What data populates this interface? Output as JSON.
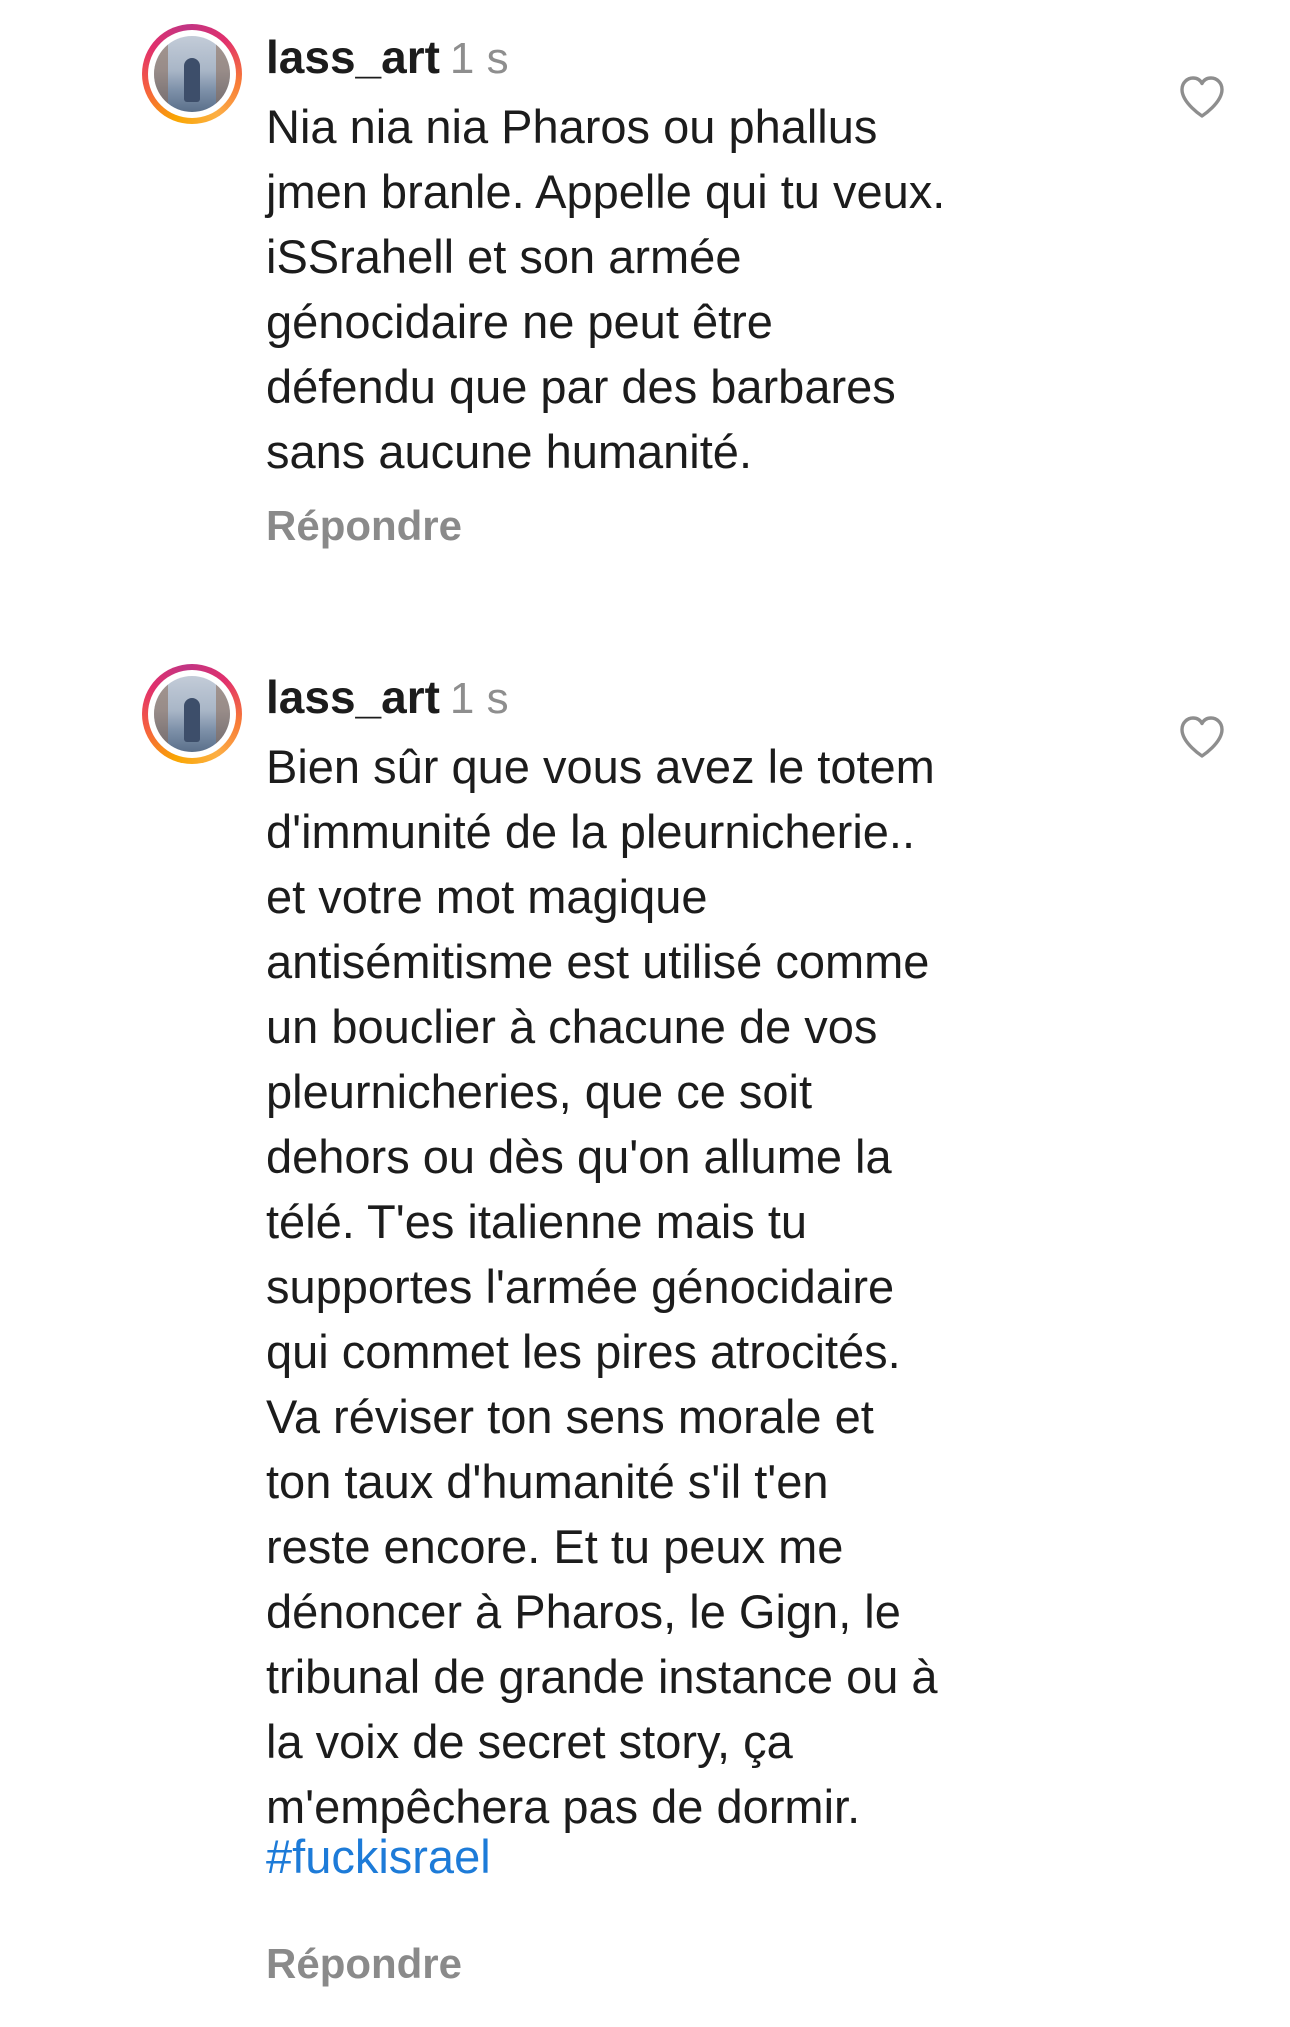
{
  "comments": [
    {
      "username": "lass_art",
      "time": "1 s",
      "text": "Nia nia nia Pharos ou phallus\njmen branle. Appelle qui tu veux.\niSSrahell et son armée\ngénocidaire ne peut être\ndéfendu que par des barbares\nsans aucune humanité.",
      "hashtag": "",
      "reply_label": "Répondre",
      "like_icon": "heart-outline-icon"
    },
    {
      "username": "lass_art",
      "time": "1 s",
      "text": "Bien sûr que vous avez le totem\nd'immunité de la pleurnicherie..\net votre mot magique\nantisémitisme est utilisé comme\nun bouclier à chacune de vos\npleurnicheries, que ce soit\ndehors ou dès qu'on allume la\ntélé. T'es italienne mais tu\nsupportes l'armée génocidaire\nqui commet les pires atrocités.\nVa réviser ton sens morale et\nton taux d'humanité s'il t'en\nreste encore. Et tu peux me\ndénoncer à Pharos, le Gign, le\ntribunal de grande instance ou à\nla voix de secret story, ça\nm'empêchera pas de dormir.",
      "hashtag": "#fuckisrael",
      "reply_label": "Répondre",
      "like_icon": "heart-outline-icon"
    }
  ],
  "colors": {
    "text": "#1c1c1c",
    "meta": "#8e8e8e",
    "hashtag": "#1d7bd8",
    "reply": "#8a8a8a"
  }
}
